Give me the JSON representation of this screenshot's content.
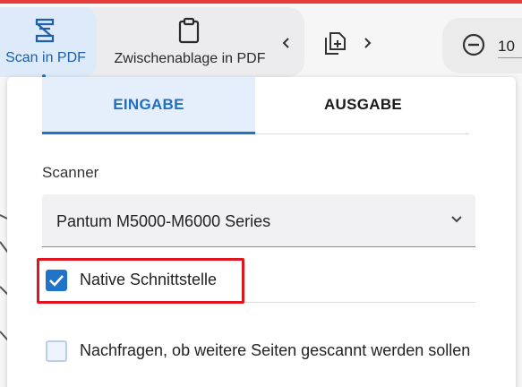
{
  "toolbar": {
    "scan_label": "Scan in PDF",
    "clipboard_label": "Zwischenablage in PDF",
    "icons": [
      "scanner-icon",
      "clipboard-icon",
      "chevron-left-icon",
      "add-document-icon",
      "chevron-right-icon",
      "zoom-out-icon"
    ],
    "zoom_value": "10",
    "accent_color": "#e53b3b"
  },
  "tabs": [
    {
      "label": "EINGABE",
      "active": true
    },
    {
      "label": "AUSGABE",
      "active": false
    }
  ],
  "scanner": {
    "label": "Scanner",
    "selected": "Pantum M5000-M6000 Series"
  },
  "options": {
    "native_interface": {
      "label": "Native Schnittstelle",
      "checked": true
    },
    "ask_more_pages": {
      "label": "Nachfragen, ob weitere Seiten gescannt werden sollen",
      "checked": false
    }
  },
  "colors": {
    "primary": "#1f73c9",
    "tab_active_bg": "#e5effb",
    "highlight": "#e0141e"
  }
}
